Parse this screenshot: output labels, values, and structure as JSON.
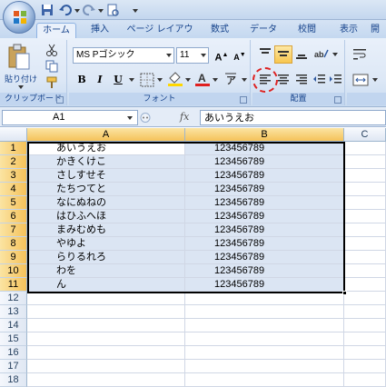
{
  "tabs": [
    {
      "label": "ホーム",
      "active": true
    },
    {
      "label": "挿入"
    },
    {
      "label": "ページ レイアウト"
    },
    {
      "label": "数式"
    },
    {
      "label": "データ"
    },
    {
      "label": "校閲"
    },
    {
      "label": "表示"
    },
    {
      "label": "開"
    }
  ],
  "ribbon": {
    "clipboard": {
      "paste_label": "貼り付け",
      "group_label": "クリップボード"
    },
    "font": {
      "font_name": "MS Pゴシック",
      "font_size": "11",
      "group_label": "フォント",
      "bold": "B",
      "italic": "I",
      "underline": "U"
    },
    "alignment": {
      "group_label": "配置"
    }
  },
  "formula_bar": {
    "name_box": "A1",
    "fx": "fx",
    "content": "あいうえお"
  },
  "columns": [
    "A",
    "B",
    "C"
  ],
  "rows": [
    {
      "n": "1",
      "a": "あいうえお",
      "b": "123456789"
    },
    {
      "n": "2",
      "a": "かきくけこ",
      "b": "123456789"
    },
    {
      "n": "3",
      "a": "さしすせそ",
      "b": "123456789"
    },
    {
      "n": "4",
      "a": "たちつてと",
      "b": "123456789"
    },
    {
      "n": "5",
      "a": "なにぬねの",
      "b": "123456789"
    },
    {
      "n": "6",
      "a": "はひふへほ",
      "b": "123456789"
    },
    {
      "n": "7",
      "a": "まみむめも",
      "b": "123456789"
    },
    {
      "n": "8",
      "a": "やゆよ",
      "b": "123456789"
    },
    {
      "n": "9",
      "a": "らりるれろ",
      "b": "123456789"
    },
    {
      "n": "10",
      "a": "わを",
      "b": "123456789"
    },
    {
      "n": "11",
      "a": "ん",
      "b": "123456789"
    },
    {
      "n": "12",
      "a": "",
      "b": ""
    },
    {
      "n": "13",
      "a": "",
      "b": ""
    },
    {
      "n": "14",
      "a": "",
      "b": ""
    },
    {
      "n": "15",
      "a": "",
      "b": ""
    },
    {
      "n": "16",
      "a": "",
      "b": ""
    },
    {
      "n": "17",
      "a": "",
      "b": ""
    },
    {
      "n": "18",
      "a": "",
      "b": ""
    }
  ],
  "colors": {
    "selection": "#dbe5f3",
    "highlight": "#f7c64f",
    "circle": "#dd2222"
  }
}
